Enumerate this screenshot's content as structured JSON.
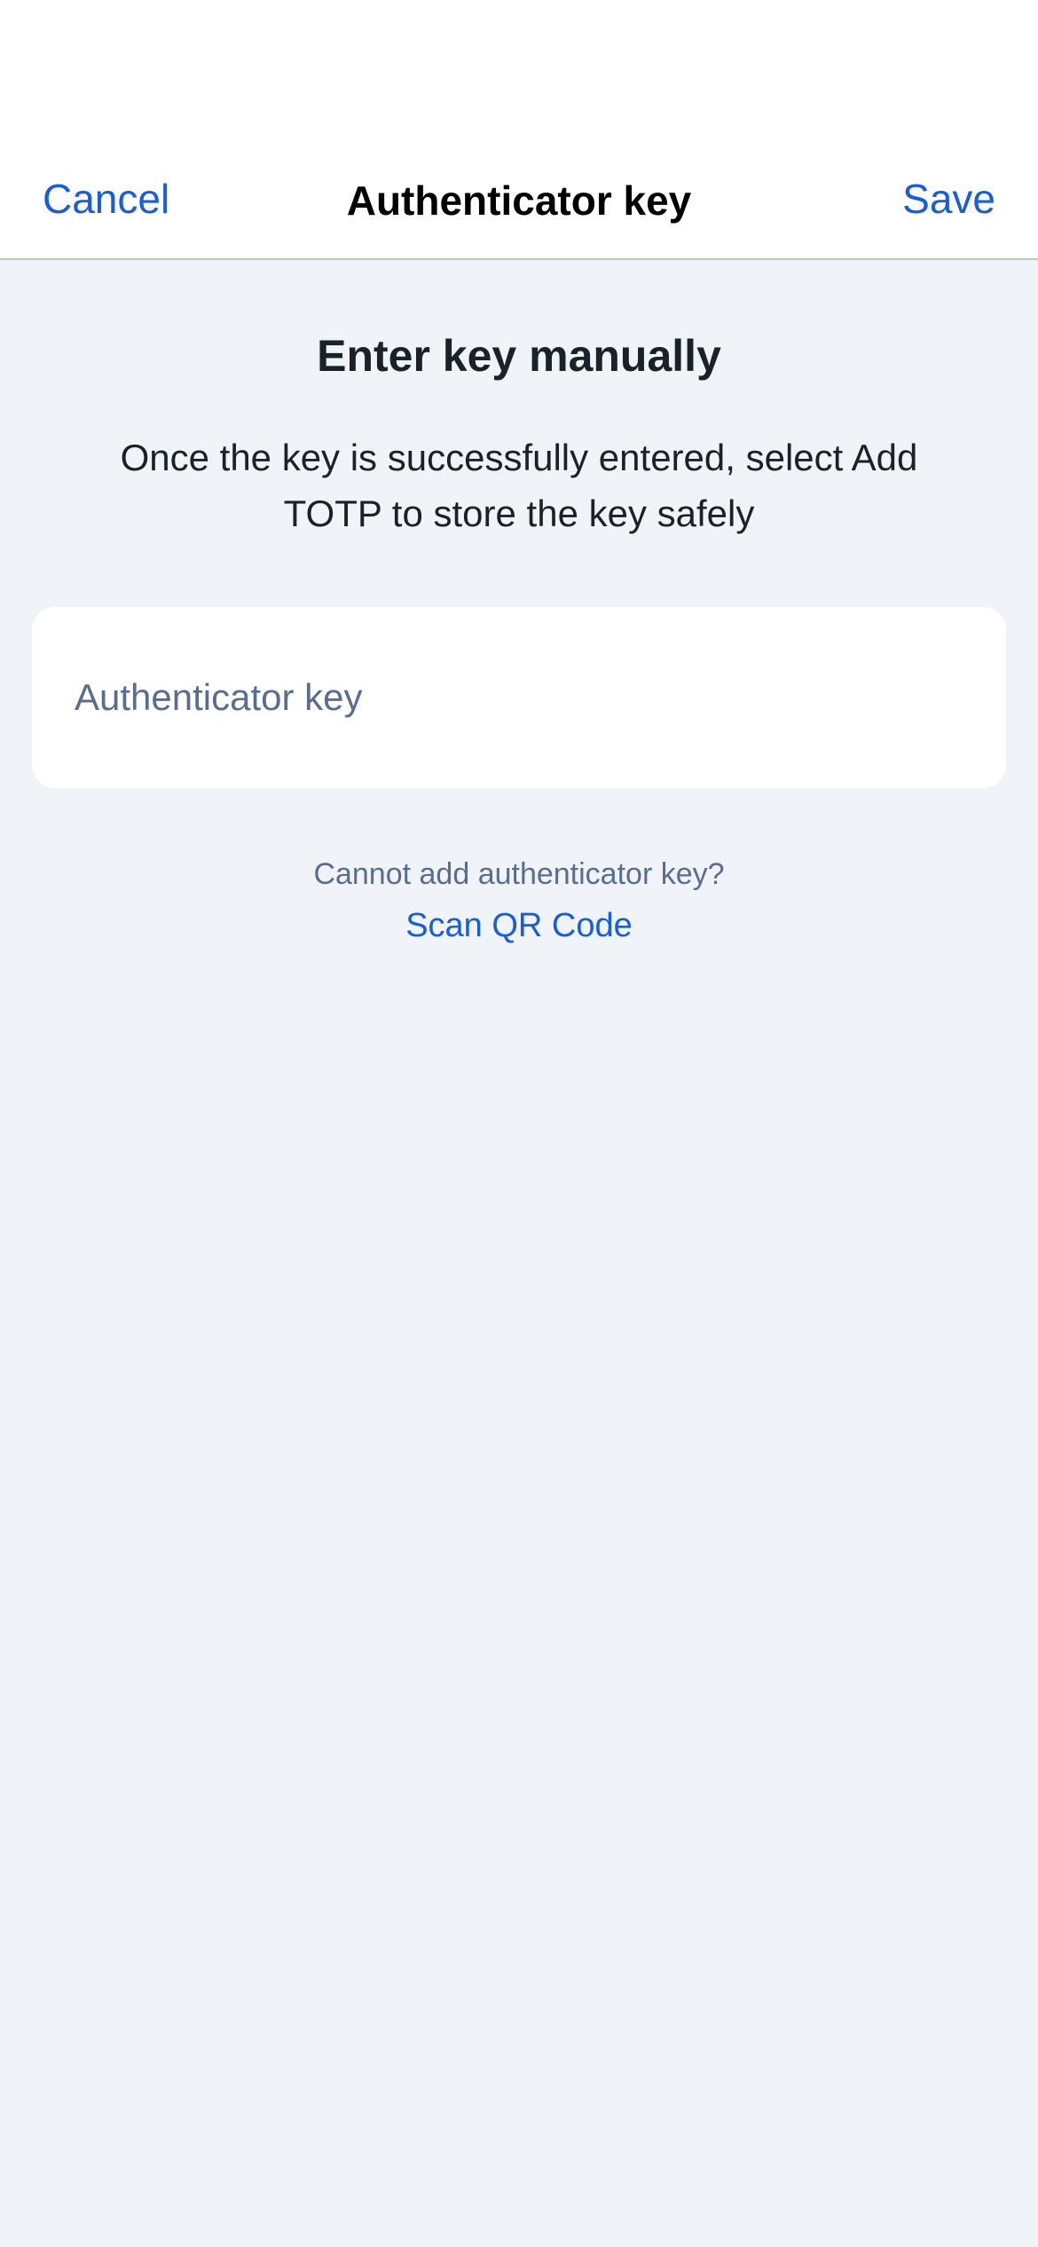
{
  "nav": {
    "cancel_label": "Cancel",
    "title": "Authenticator key",
    "save_label": "Save"
  },
  "content": {
    "heading": "Enter key manually",
    "description": "Once the key is successfully entered, select Add TOTP to store the key safely"
  },
  "key_field": {
    "placeholder": "Authenticator key",
    "value": ""
  },
  "help": {
    "text": "Cannot add authenticator key?",
    "link_label": "Scan QR Code"
  },
  "colors": {
    "accent": "#175ddc",
    "background": "#f0f4f8",
    "text_primary": "#1b2129",
    "text_muted": "#5a6d91"
  }
}
